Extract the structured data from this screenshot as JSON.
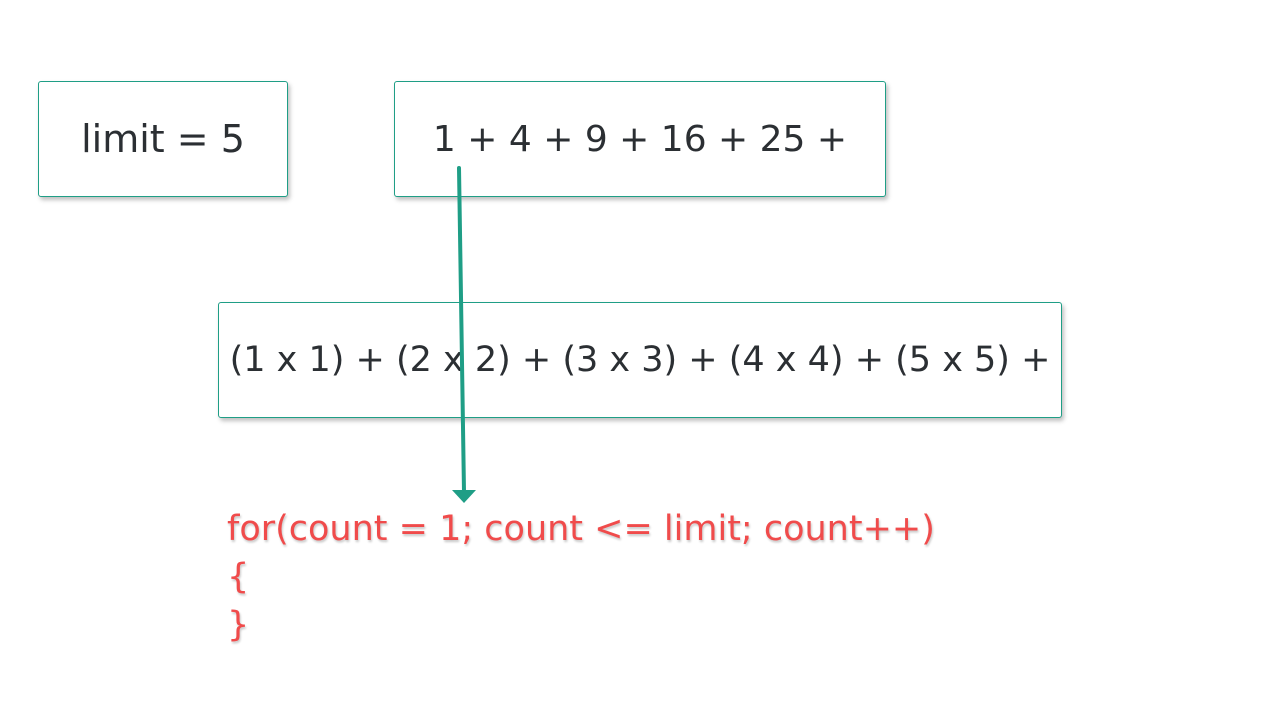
{
  "boxes": {
    "limit": "limit = 5",
    "series": "1 + 4 + 9 + 16 + 25 +",
    "expansion": "(1 x 1) + (2 x 2) + (3 x 3) + (4 x 4) + (5 x 5) +"
  },
  "code": {
    "line1": "for(count = 1; count <= limit; count++)",
    "line2": "{",
    "line3": "}"
  },
  "colors": {
    "box_border": "#1f9e86",
    "arrow": "#1f9e86",
    "code_text": "#f04b4b",
    "box_text": "#2b2f33"
  }
}
